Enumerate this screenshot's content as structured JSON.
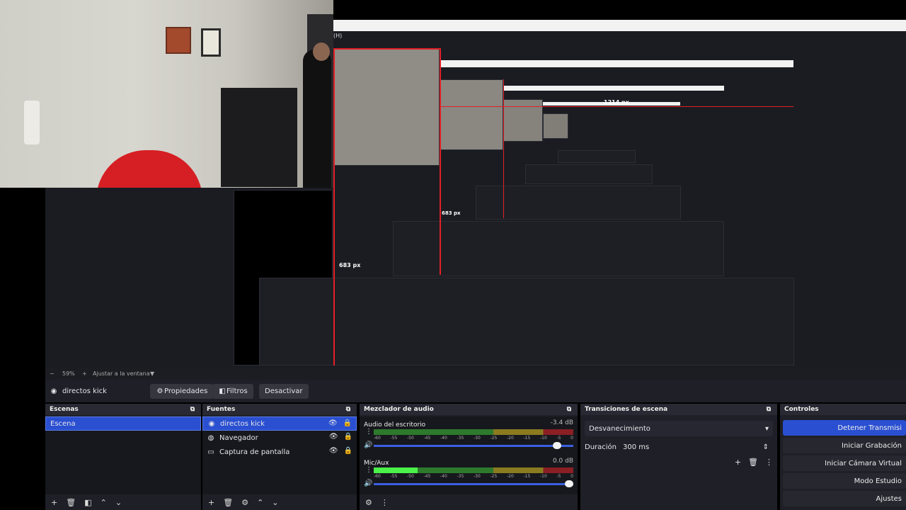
{
  "preview": {
    "h_label": "(H)",
    "width_label": "1214 px",
    "height_label_small": "683 px",
    "height_label": "683 px"
  },
  "zoom": {
    "minus": "−",
    "value": "59%",
    "plus": "+",
    "fit_label": "Ajustar a la ventana"
  },
  "toolbar": {
    "source_name": "directos kick",
    "properties_label": "Propiedades",
    "filters_label": "Filtros",
    "deactivate_label": "Desactivar"
  },
  "scenes": {
    "title": "Escenas",
    "items": [
      "Escena"
    ]
  },
  "sources": {
    "title": "Fuentes",
    "items": [
      {
        "label": "directos kick",
        "icon": "camera-icon"
      },
      {
        "label": "Navegador",
        "icon": "globe-icon"
      },
      {
        "label": "Captura de pantalla",
        "icon": "monitor-icon"
      }
    ]
  },
  "mixer": {
    "title": "Mezclador de audio",
    "scale": [
      "-60",
      "-55",
      "-50",
      "-45",
      "-40",
      "-35",
      "-30",
      "-25",
      "-20",
      "-15",
      "-10",
      "-5",
      "0"
    ],
    "channels": [
      {
        "name": "Audio del escritorio",
        "db": "-3.4 dB",
        "level": 0.0,
        "volume": 0.94
      },
      {
        "name": "Mic/Aux",
        "db": "0.0 dB",
        "level": 0.22,
        "volume": 1.0
      }
    ]
  },
  "transitions": {
    "title": "Transiciones de escena",
    "selected": "Desvanecimiento",
    "duration_label": "Duración",
    "duration_value": "300 ms"
  },
  "controls": {
    "title": "Controles",
    "buttons": [
      "Detener Transmisi",
      "Iniciar Grabación",
      "Iniciar Cámara Virtual",
      "Modo Estudio",
      "Ajustes"
    ]
  },
  "colors": {
    "accent": "#2a4fd1",
    "red": "#e21f26",
    "panel": "#1f2027"
  }
}
